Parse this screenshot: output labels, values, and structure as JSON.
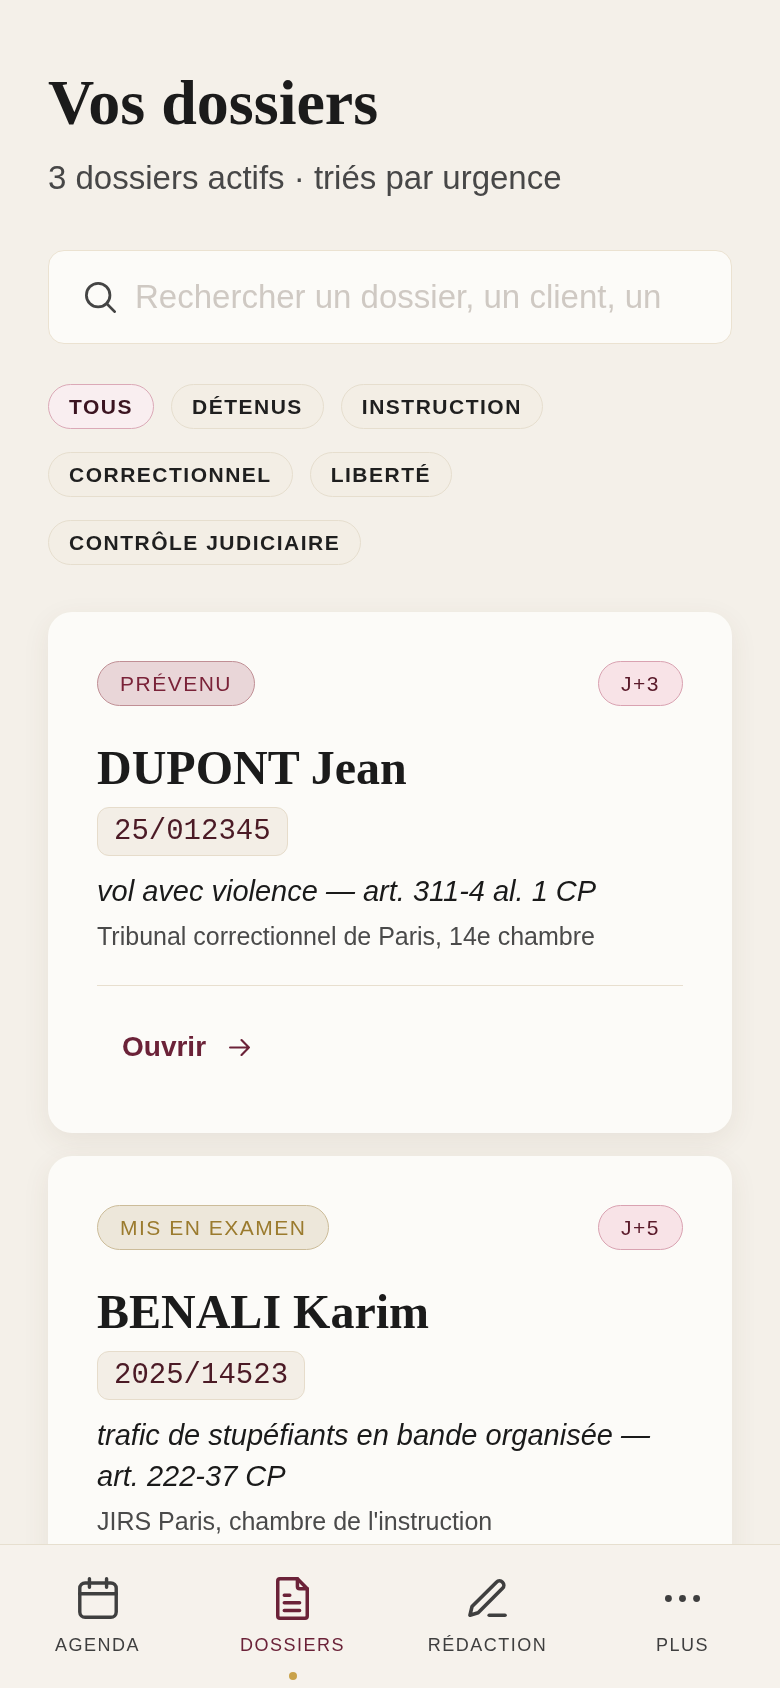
{
  "header": {
    "title": "Vos dossiers",
    "subtitle": "3 dossiers actifs · triés par urgence"
  },
  "search": {
    "placeholder": "Rechercher un dossier, un client, un"
  },
  "filters": [
    {
      "label": "TOUS",
      "selected": true
    },
    {
      "label": "DÉTENUS",
      "selected": false
    },
    {
      "label": "INSTRUCTION",
      "selected": false
    },
    {
      "label": "CORRECTIONNEL",
      "selected": false
    },
    {
      "label": "LIBERTÉ",
      "selected": false
    },
    {
      "label": "CONTRÔLE JUDICIAIRE",
      "selected": false
    }
  ],
  "cases": [
    {
      "role": {
        "label": "PRÉVENU",
        "color": "#7a2238"
      },
      "deadline": "J+3",
      "name": "DUPONT Jean",
      "number": "25/012345",
      "charge": "vol avec violence — art. 311-4 al. 1 CP",
      "court": "Tribunal correctionnel de Paris, 14e chambre",
      "action": "Ouvrir"
    },
    {
      "role": {
        "label": "MIS EN EXAMEN",
        "color": "#9b7b2e"
      },
      "deadline": "J+5",
      "name": "BENALI Karim",
      "number": "2025/14523",
      "charge": "trafic de stupéfiants en bande organisée — art. 222-37 CP",
      "court": "JIRS Paris, chambre de l'instruction"
    }
  ],
  "nav": [
    {
      "label": "AGENDA",
      "selected": false
    },
    {
      "label": "DOSSIERS",
      "selected": true
    },
    {
      "label": "RÉDACTION",
      "selected": false
    },
    {
      "label": "PLUS",
      "selected": false
    }
  ]
}
